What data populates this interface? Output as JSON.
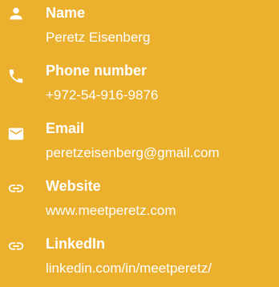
{
  "contacts": [
    {
      "icon": "person-icon",
      "label": "Name",
      "value": "Peretz Eisenberg"
    },
    {
      "icon": "phone-icon",
      "label": "Phone number",
      "value": "+972-54-916-9876"
    },
    {
      "icon": "email-icon",
      "label": "Email",
      "value": "peretzeisenberg@gmail.com"
    },
    {
      "icon": "link-icon",
      "label": "Website",
      "value": "www.meetperetz.com"
    },
    {
      "icon": "link-icon",
      "label": "LinkedIn",
      "value": "linkedin.com/in/meetperetz/"
    }
  ],
  "colors": {
    "background": "#ecb02f",
    "text": "#ffffff"
  }
}
